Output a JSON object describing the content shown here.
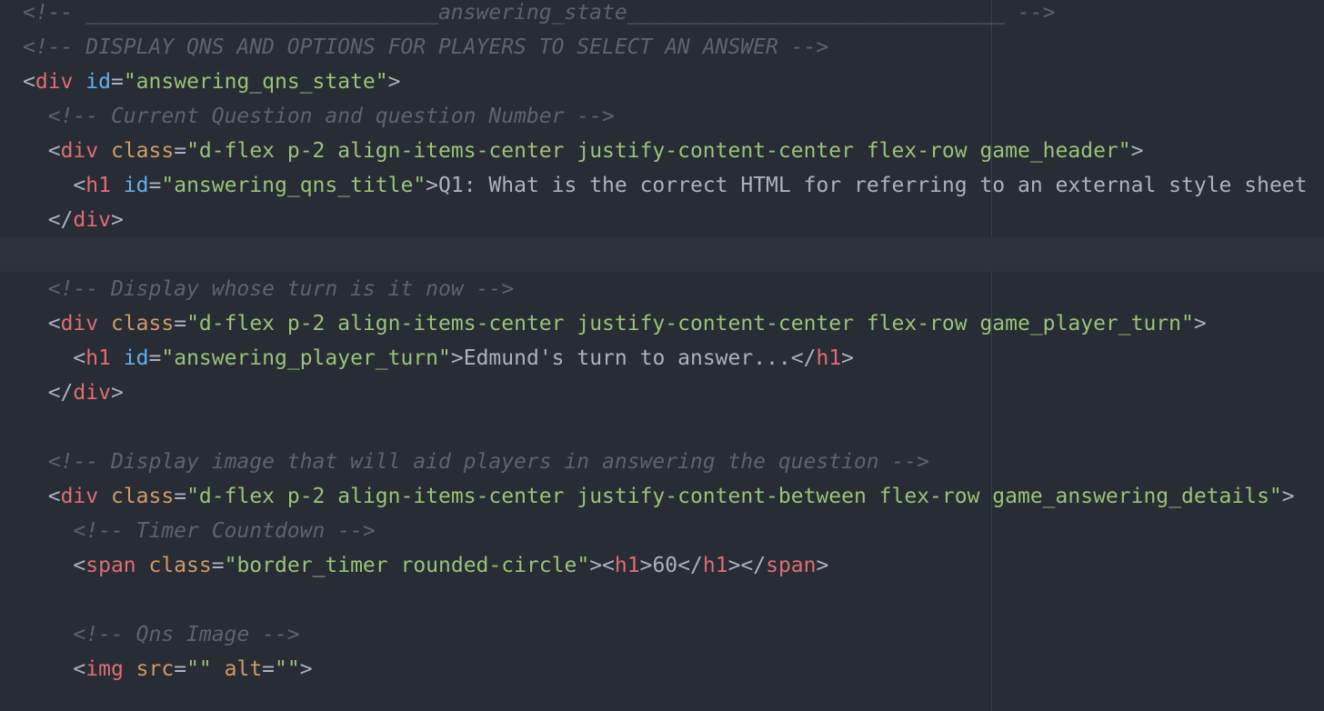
{
  "editor": {
    "colors": {
      "background": "#282c34",
      "current_line": "#2c313a",
      "comment": "#5c6370",
      "tag": "#e06c75",
      "id_attr": "#61afef",
      "attr": "#d19a66",
      "string": "#98c379",
      "text": "#abb2bf"
    },
    "current_line_index": 7,
    "lines": [
      {
        "indent": "",
        "tokens": [
          {
            "t": "comment",
            "v": "<!-- ____________________________answering_state______________________________ -->"
          }
        ]
      },
      {
        "indent": "",
        "tokens": [
          {
            "t": "comment",
            "v": "<!-- DISPLAY QNS AND OPTIONS FOR PLAYERS TO SELECT AN ANSWER -->"
          }
        ]
      },
      {
        "indent": "",
        "tokens": [
          {
            "t": "punct",
            "v": "<"
          },
          {
            "t": "tag",
            "v": "div"
          },
          {
            "t": "punct",
            "v": " "
          },
          {
            "t": "id",
            "v": "id"
          },
          {
            "t": "punct",
            "v": "="
          },
          {
            "t": "str",
            "v": "\"answering_qns_state\""
          },
          {
            "t": "punct",
            "v": ">"
          }
        ]
      },
      {
        "indent": "  ",
        "tokens": [
          {
            "t": "comment",
            "v": "<!-- Current Question and question Number -->"
          }
        ]
      },
      {
        "indent": "  ",
        "tokens": [
          {
            "t": "punct",
            "v": "<"
          },
          {
            "t": "tag",
            "v": "div"
          },
          {
            "t": "punct",
            "v": " "
          },
          {
            "t": "attr",
            "v": "class"
          },
          {
            "t": "punct",
            "v": "="
          },
          {
            "t": "str",
            "v": "\"d-flex p-2 align-items-center justify-content-center flex-row game_header\""
          },
          {
            "t": "punct",
            "v": ">"
          }
        ]
      },
      {
        "indent": "    ",
        "tokens": [
          {
            "t": "punct",
            "v": "<"
          },
          {
            "t": "tag",
            "v": "h1"
          },
          {
            "t": "punct",
            "v": " "
          },
          {
            "t": "id",
            "v": "id"
          },
          {
            "t": "punct",
            "v": "="
          },
          {
            "t": "str",
            "v": "\"answering_qns_title\""
          },
          {
            "t": "punct",
            "v": ">"
          },
          {
            "t": "text",
            "v": "Q1: What is the correct HTML for referring to an external style sheet"
          }
        ]
      },
      {
        "indent": "  ",
        "tokens": [
          {
            "t": "punct",
            "v": "</"
          },
          {
            "t": "tag",
            "v": "div"
          },
          {
            "t": "punct",
            "v": ">"
          }
        ]
      },
      {
        "indent": "",
        "tokens": []
      },
      {
        "indent": "  ",
        "tokens": [
          {
            "t": "comment",
            "v": "<!-- Display whose turn is it now -->"
          }
        ]
      },
      {
        "indent": "  ",
        "tokens": [
          {
            "t": "punct",
            "v": "<"
          },
          {
            "t": "tag",
            "v": "div"
          },
          {
            "t": "punct",
            "v": " "
          },
          {
            "t": "attr",
            "v": "class"
          },
          {
            "t": "punct",
            "v": "="
          },
          {
            "t": "str",
            "v": "\"d-flex p-2 align-items-center justify-content-center flex-row game_player_turn\""
          },
          {
            "t": "punct",
            "v": ">"
          }
        ]
      },
      {
        "indent": "    ",
        "tokens": [
          {
            "t": "punct",
            "v": "<"
          },
          {
            "t": "tag",
            "v": "h1"
          },
          {
            "t": "punct",
            "v": " "
          },
          {
            "t": "id",
            "v": "id"
          },
          {
            "t": "punct",
            "v": "="
          },
          {
            "t": "str",
            "v": "\"answering_player_turn\""
          },
          {
            "t": "punct",
            "v": ">"
          },
          {
            "t": "text",
            "v": "Edmund's turn to answer..."
          },
          {
            "t": "punct",
            "v": "</"
          },
          {
            "t": "tag",
            "v": "h1"
          },
          {
            "t": "punct",
            "v": ">"
          }
        ]
      },
      {
        "indent": "  ",
        "tokens": [
          {
            "t": "punct",
            "v": "</"
          },
          {
            "t": "tag",
            "v": "div"
          },
          {
            "t": "punct",
            "v": ">"
          }
        ]
      },
      {
        "indent": "",
        "tokens": []
      },
      {
        "indent": "  ",
        "tokens": [
          {
            "t": "comment",
            "v": "<!-- Display image that will aid players in answering the question -->"
          }
        ]
      },
      {
        "indent": "  ",
        "tokens": [
          {
            "t": "punct",
            "v": "<"
          },
          {
            "t": "tag",
            "v": "div"
          },
          {
            "t": "punct",
            "v": " "
          },
          {
            "t": "attr",
            "v": "class"
          },
          {
            "t": "punct",
            "v": "="
          },
          {
            "t": "str",
            "v": "\"d-flex p-2 align-items-center justify-content-between flex-row game_answering_details\""
          },
          {
            "t": "punct",
            "v": ">"
          }
        ]
      },
      {
        "indent": "    ",
        "tokens": [
          {
            "t": "comment",
            "v": "<!-- Timer Countdown -->"
          }
        ]
      },
      {
        "indent": "    ",
        "tokens": [
          {
            "t": "punct",
            "v": "<"
          },
          {
            "t": "tag",
            "v": "span"
          },
          {
            "t": "punct",
            "v": " "
          },
          {
            "t": "attr",
            "v": "class"
          },
          {
            "t": "punct",
            "v": "="
          },
          {
            "t": "str",
            "v": "\"border_timer rounded-circle\""
          },
          {
            "t": "punct",
            "v": "><"
          },
          {
            "t": "tag",
            "v": "h1"
          },
          {
            "t": "punct",
            "v": ">"
          },
          {
            "t": "text",
            "v": "60"
          },
          {
            "t": "punct",
            "v": "</"
          },
          {
            "t": "tag",
            "v": "h1"
          },
          {
            "t": "punct",
            "v": "></"
          },
          {
            "t": "tag",
            "v": "span"
          },
          {
            "t": "punct",
            "v": ">"
          }
        ]
      },
      {
        "indent": "",
        "tokens": []
      },
      {
        "indent": "    ",
        "tokens": [
          {
            "t": "comment",
            "v": "<!-- Qns Image -->"
          }
        ]
      },
      {
        "indent": "    ",
        "tokens": [
          {
            "t": "punct",
            "v": "<"
          },
          {
            "t": "tag",
            "v": "img"
          },
          {
            "t": "punct",
            "v": " "
          },
          {
            "t": "attr",
            "v": "src"
          },
          {
            "t": "punct",
            "v": "="
          },
          {
            "t": "str",
            "v": "\"\""
          },
          {
            "t": "punct",
            "v": " "
          },
          {
            "t": "attr",
            "v": "alt"
          },
          {
            "t": "punct",
            "v": "="
          },
          {
            "t": "str",
            "v": "\"\""
          },
          {
            "t": "punct",
            "v": ">"
          }
        ]
      }
    ]
  }
}
